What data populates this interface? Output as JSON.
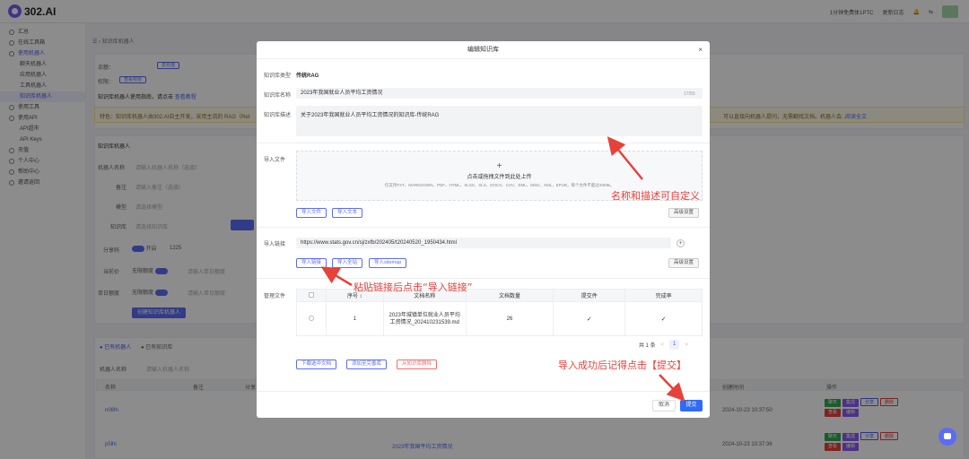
{
  "app": {
    "logo_text": "302.AI",
    "top_right": [
      "1分钟免费体1PTC",
      "更新日志",
      "🔔",
      "⇆"
    ]
  },
  "sidebar": {
    "items": [
      {
        "label": "汇总",
        "sub": false
      },
      {
        "label": "在线工具箱",
        "sub": false
      },
      {
        "label": "使用机器人",
        "sub": false,
        "active_group": true
      },
      {
        "label": "聊天机器人",
        "sub": true
      },
      {
        "label": "应用机器人",
        "sub": true
      },
      {
        "label": "工具机器人",
        "sub": true
      },
      {
        "label": "知识库机器人",
        "sub": true,
        "active": true
      },
      {
        "label": "使用工具",
        "sub": false
      },
      {
        "label": "使用API",
        "sub": false
      },
      {
        "label": "API超市",
        "sub": true
      },
      {
        "label": "API Keys",
        "sub": true
      },
      {
        "label": "充值",
        "sub": false
      },
      {
        "label": "个人中心",
        "sub": false
      },
      {
        "label": "帮助中心",
        "sub": false
      },
      {
        "label": "邀请返回",
        "sub": false
      }
    ]
  },
  "background": {
    "breadcrumb": "知识库机器人",
    "balance_label": "余额：",
    "recharge": "去充值",
    "permission_label": "权限：",
    "permission_value": "查看权限",
    "howto": "知识库机器人使用指南，请点击",
    "howto_link": "查看教程",
    "notice": "特色：知识库机器人由302.AI自主开发，采用主流的 RAG（Ret",
    "notice_tail": "可以直接向机器人提问，无需翻找文档。机器人会…",
    "notice_link": "阅读全文",
    "create_section": "知识库机器人",
    "form_labels": [
      "机器人名称",
      "备注",
      "模型",
      "知识库",
      "分享码",
      "当前价",
      "单日额度"
    ],
    "form_placeholders": [
      "请输入机器人名称（选填）",
      "请输入备注（选填）",
      "请选择模型",
      "请选择知识库",
      "1225",
      "请输入单日额度",
      "请输入单日额度"
    ],
    "toggle_text": "开启",
    "unlimited_text": "无限额度",
    "create_button": "创建知识库机器人",
    "tabs": [
      "已有机器人",
      "已有知识库"
    ],
    "filter_label": "机器人名称",
    "filter_placeholder": "请输入机器人名称",
    "table_headers": [
      "名称",
      "备注",
      "分享",
      "创建时间",
      "操作"
    ],
    "rows": [
      {
        "name": "n06fn",
        "time": "2024-10-23 10:37:50"
      },
      {
        "name": "p5lhi",
        "time": "2024-10-23 10:37:36",
        "kb": "2023年我国平均工资情况"
      }
    ],
    "row_ops": [
      "聊天",
      "集成",
      "分享",
      "删除",
      "查看",
      "编辑"
    ]
  },
  "modal": {
    "title": "编辑知识库",
    "close": "×",
    "type_label": "知识库类型",
    "type_value": "传统RAG",
    "name_label": "知识库名称",
    "name_value": "2023年我国就业人员平均工资情况",
    "name_counter": "17/50",
    "desc_label": "知识库描述",
    "desc_value": "关于2023年我国就业人员平均工资情况的知识库-传统RAG",
    "import_file_label": "导入文件",
    "drop_plus": "+",
    "drop_main": "点击或拖拽文件到此处上传",
    "drop_sub": "仅支持TXT、MARKDOWN、PDF、HTML、XLSX、XLS、DOCX、CSV、EML、MSG、XML、EPUB，每个文件不超过20MB。",
    "import_file_btn": "导入文件",
    "import_text_btn": "导入文本",
    "advanced_btn": "高级设置",
    "import_link_label": "导入链接",
    "link_value": "https://www.stats.gov.cn/sj/zxfb/202405/t20240520_1950434.html",
    "add_link_btn": "+",
    "import_link_btn": "导入链接",
    "import_site_btn": "导入全站",
    "import_sitemap_btn": "导入sitemap",
    "advanced_btn2": "高级设置",
    "manage_label": "管理文件",
    "table_headers": [
      "序号 ↕",
      "文档名称",
      "文档数量",
      "提交件",
      "完成率"
    ],
    "table_rows": [
      {
        "index": "1",
        "doc": "2023年城镇单位就业人员平均工资情况_202410231539.md",
        "count": "26",
        "submitted": "✓",
        "done": "✓"
      }
    ],
    "total": "共 1 条",
    "prev": "<",
    "page": "1",
    "next": ">",
    "download_btn": "下载选中文档",
    "add_kb_btn": "添加至完善库",
    "remove_btn": "从知识库删除",
    "cancel_btn": "取消",
    "submit_btn": "提交"
  },
  "annotations": {
    "name_desc": "名称和描述可自定义",
    "paste_link": "粘贴链接后点击“导入链接”",
    "submit_hint": "导入成功后记得点击【提交】"
  },
  "colors": {
    "accent": "#5b6cf7",
    "submit": "#2f6bf6",
    "annotation": "#e8413a"
  }
}
